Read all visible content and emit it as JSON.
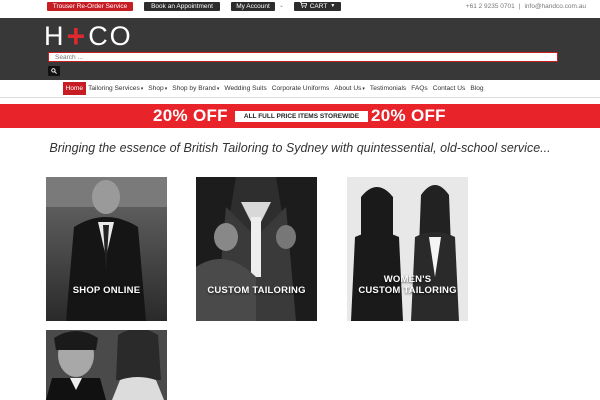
{
  "utility_bar": {
    "trouser_reorder": "Trouser Re-Order Service",
    "book_appointment": "Book an Appointment",
    "my_account": "My Account",
    "cart": "CART",
    "phone": "+61 2 9235 0701",
    "divider": "|",
    "email": "info@handco.com.au"
  },
  "logo": {
    "left": "H",
    "plus": "+",
    "right": "CO"
  },
  "search": {
    "placeholder": "Search ..."
  },
  "nav": [
    {
      "label": "Home",
      "active": true,
      "has_dropdown": false
    },
    {
      "label": "Tailoring Services",
      "active": false,
      "has_dropdown": true
    },
    {
      "label": "Shop",
      "active": false,
      "has_dropdown": true
    },
    {
      "label": "Shop by Brand",
      "active": false,
      "has_dropdown": true
    },
    {
      "label": "Wedding Suits",
      "active": false,
      "has_dropdown": false
    },
    {
      "label": "Corporate Uniforms",
      "active": false,
      "has_dropdown": false
    },
    {
      "label": "About Us",
      "active": false,
      "has_dropdown": true
    },
    {
      "label": "Testimonials",
      "active": false,
      "has_dropdown": false
    },
    {
      "label": "FAQs",
      "active": false,
      "has_dropdown": false
    },
    {
      "label": "Contact Us",
      "active": false,
      "has_dropdown": false
    },
    {
      "label": "Blog",
      "active": false,
      "has_dropdown": false
    }
  ],
  "promo": {
    "left": "20% OFF",
    "middle": "ALL FULL PRICE ITEMS STOREWIDE",
    "right": "20% OFF"
  },
  "tagline": "Bringing the essence of British Tailoring to Sydney with quintessential, old-school service...",
  "tiles": [
    {
      "label_line1": "SHOP ONLINE",
      "label_line2": ""
    },
    {
      "label_line1": "CUSTOM TAILORING",
      "label_line2": ""
    },
    {
      "label_line1": "WOMEN'S",
      "label_line2": "CUSTOM TAILORING"
    },
    {
      "label_line1": "",
      "label_line2": ""
    }
  ],
  "colors": {
    "brand_red": "#c61d24",
    "promo_red": "#e8232a",
    "header_dark": "#383838"
  },
  "icons": {
    "search_button": "search-icon",
    "cart": "cart-icon",
    "dropdown": "caret-down-icon"
  }
}
